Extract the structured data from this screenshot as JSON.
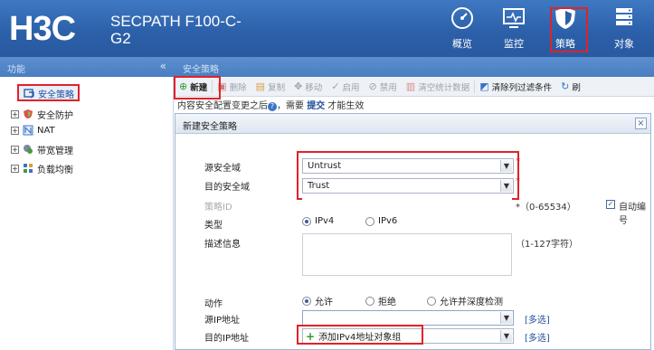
{
  "header": {
    "logo": "H3C",
    "model": "SECPATH F100-C-G2",
    "nav": [
      {
        "label": "概览",
        "icon": "dashboard-icon"
      },
      {
        "label": "监控",
        "icon": "monitor-icon"
      },
      {
        "label": "策略",
        "icon": "shield-icon"
      },
      {
        "label": "对象",
        "icon": "server-icon"
      }
    ]
  },
  "sidebar": {
    "head": "功能",
    "collapse": "«",
    "items": [
      {
        "label": "安全策略",
        "icon": "policy-icon",
        "selected": true
      },
      {
        "label": "安全防护",
        "icon": "defense-icon"
      },
      {
        "label": "NAT",
        "icon": "nat-icon"
      },
      {
        "label": "带宽管理",
        "icon": "bandwidth-icon"
      },
      {
        "label": "负载均衡",
        "icon": "loadbalance-icon"
      }
    ]
  },
  "tab": {
    "label": "安全策略"
  },
  "toolbar": {
    "new": "新建",
    "delete": "删除",
    "copy": "复制",
    "move": "移动",
    "enable": "启用",
    "disable": "禁用",
    "clear_stats": "清空统计数据",
    "clear_filter": "清除列过滤条件",
    "refresh": "刷"
  },
  "hint": {
    "before": "内容安全配置变更之后",
    "mid": "，需要",
    "link": "提交",
    "after": "才能生效"
  },
  "dialog": {
    "title": "新建安全策略",
    "close": "×",
    "labels": {
      "src_zone": "源安全域",
      "dst_zone": "目的安全域",
      "policy_id": "策略ID",
      "type": "类型",
      "desc": "描述信息",
      "action": "动作",
      "src_ip": "源IP地址",
      "dst_ip": "目的IP地址"
    },
    "src_zone_value": "Untrust",
    "dst_zone_value": "Trust",
    "required": "*",
    "policy_id_range": "*（0-65534）",
    "auto_number": "自动编号",
    "type_options": [
      "IPv4",
      "IPv6"
    ],
    "desc_range": "（1-127字符）",
    "action_options": [
      "允许",
      "拒绝",
      "允许并深度检测"
    ],
    "multi_select": "[多选]",
    "add_ipv4_obj": "添加IPv4地址对象组"
  },
  "colors": {
    "header_bg": "#2b5fa8",
    "highlight": "#e0222a",
    "accent": "#2f9d2f"
  }
}
